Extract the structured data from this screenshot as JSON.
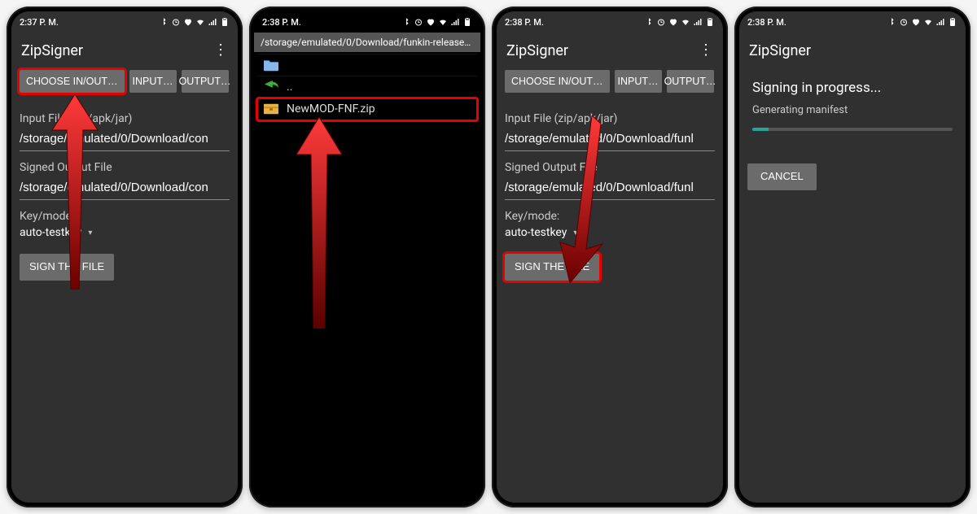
{
  "screens": [
    {
      "status_time": "2:37 P. M.",
      "appbar_title": "ZipSigner",
      "buttons": {
        "choose": "CHOOSE IN/OUT…",
        "input": "INPUT…",
        "output": "OUTPUT…"
      },
      "labels": {
        "input_file": "Input File (zip/apk/jar)",
        "output_file": "Signed Output File",
        "keymode": "Key/mode:"
      },
      "values": {
        "input_path": "/storage/emulated/0/Download/con",
        "output_path": "/storage/emulated/0/Download/con",
        "keymode": "auto-testkey"
      },
      "sign_button": "SIGN THE FILE"
    },
    {
      "status_time": "2:38 P. M.",
      "pathbar": "/storage/emulated/0/Download/funkin-release…",
      "rows": {
        "up": "..",
        "file": "NewMOD-FNF.zip"
      }
    },
    {
      "status_time": "2:38 P. M.",
      "appbar_title": "ZipSigner",
      "buttons": {
        "choose": "CHOOSE IN/OUT…",
        "input": "INPUT…",
        "output": "OUTPUT…"
      },
      "labels": {
        "input_file": "Input File (zip/apk/jar)",
        "output_file": "Signed Output File",
        "keymode": "Key/mode:"
      },
      "values": {
        "input_path": "/storage/emulated/0/Download/funl",
        "output_path": "/storage/emulated/0/Download/funl",
        "keymode": "auto-testkey"
      },
      "sign_button": "SIGN THE FILE"
    },
    {
      "status_time": "2:38 P. M.",
      "appbar_title": "ZipSigner",
      "progress_title": "Signing in progress...",
      "progress_sub": "Generating manifest",
      "cancel": "CANCEL"
    }
  ]
}
